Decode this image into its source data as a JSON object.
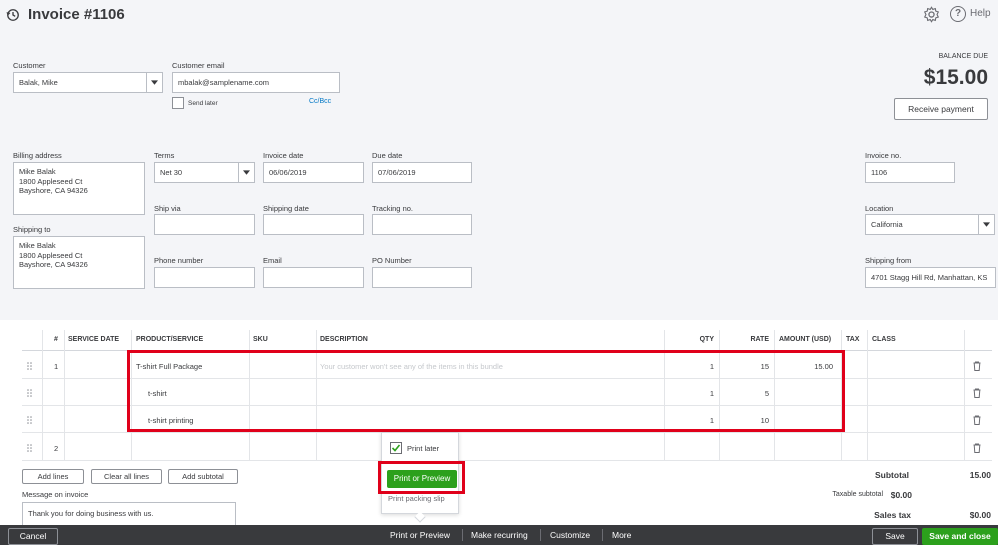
{
  "header": {
    "title": "Invoice #1106",
    "help_label": "Help",
    "help_glyph": "?"
  },
  "customer": {
    "label": "Customer",
    "value": "Balak, Mike"
  },
  "customer_email": {
    "label": "Customer email",
    "value": "mbalak@samplename.com",
    "send_later_label": "Send later",
    "cc_bcc_label": "Cc/Bcc"
  },
  "balance": {
    "label": "BALANCE DUE",
    "amount": "$15.00",
    "receive_payment_label": "Receive payment"
  },
  "billing": {
    "label": "Billing address",
    "lines": [
      "Mike Balak",
      "1800 Appleseed Ct",
      "Bayshore, CA 94326"
    ]
  },
  "shipping_to": {
    "label": "Shipping to",
    "lines": [
      "Mike Balak",
      "1800 Appleseed Ct",
      "Bayshore, CA 94326"
    ]
  },
  "terms": {
    "label": "Terms",
    "value": "Net 30"
  },
  "invoice_date": {
    "label": "Invoice date",
    "value": "06/06/2019"
  },
  "due_date": {
    "label": "Due date",
    "value": "07/06/2019"
  },
  "ship_via": {
    "label": "Ship via",
    "value": ""
  },
  "shipping_date": {
    "label": "Shipping date",
    "value": ""
  },
  "tracking_no": {
    "label": "Tracking no.",
    "value": ""
  },
  "phone_number": {
    "label": "Phone number",
    "value": ""
  },
  "email": {
    "label": "Email",
    "value": ""
  },
  "po_number": {
    "label": "PO Number",
    "value": ""
  },
  "invoice_no": {
    "label": "Invoice no.",
    "value": "1106"
  },
  "location": {
    "label": "Location",
    "value": "California"
  },
  "shipping_from": {
    "label": "Shipping from",
    "value": "4701 Stagg Hill Rd, Manhattan, KS"
  },
  "table": {
    "headers": {
      "num": "#",
      "service_date": "SERVICE DATE",
      "product": "PRODUCT/SERVICE",
      "sku": "SKU",
      "description": "DESCRIPTION",
      "qty": "QTY",
      "rate": "RATE",
      "amount": "AMOUNT (USD)",
      "tax": "TAX",
      "class": "CLASS"
    },
    "rows": [
      {
        "num": "1",
        "product": "T-shirt Full Package",
        "description": "Your customer won't see any of the items in this bundle",
        "qty": "1",
        "rate": "15",
        "amount": "15.00"
      },
      {
        "num": "",
        "product": "t-shirt",
        "description": "",
        "qty": "1",
        "rate": "5",
        "amount": ""
      },
      {
        "num": "",
        "product": "t-shirt printing",
        "description": "",
        "qty": "1",
        "rate": "10",
        "amount": ""
      },
      {
        "num": "2",
        "product": "",
        "description": "",
        "qty": "",
        "rate": "",
        "amount": ""
      }
    ]
  },
  "table_actions": {
    "add_lines": "Add lines",
    "clear_all_lines": "Clear all lines",
    "add_subtotal": "Add subtotal"
  },
  "message": {
    "label": "Message on invoice",
    "value": "Thank you for doing business with us."
  },
  "totals": {
    "subtotal_label": "Subtotal",
    "subtotal_value": "15.00",
    "taxable_subtotal_label": "Taxable subtotal",
    "taxable_subtotal_value": "$0.00",
    "sales_tax_label": "Sales tax",
    "sales_tax_value": "$0.00"
  },
  "print_popup": {
    "print_later_label": "Print later",
    "print_or_preview_label": "Print or Preview",
    "print_packing_slip_label": "Print packing slip"
  },
  "footer": {
    "cancel": "Cancel",
    "print_or_preview": "Print or Preview",
    "make_recurring": "Make recurring",
    "customize": "Customize",
    "more": "More",
    "save": "Save",
    "save_and_close": "Save and close"
  },
  "colors": {
    "green": "#2ca01c",
    "footer_bg": "#393a3d",
    "highlight_red": "#e0001a",
    "link_blue": "#0077c5"
  }
}
